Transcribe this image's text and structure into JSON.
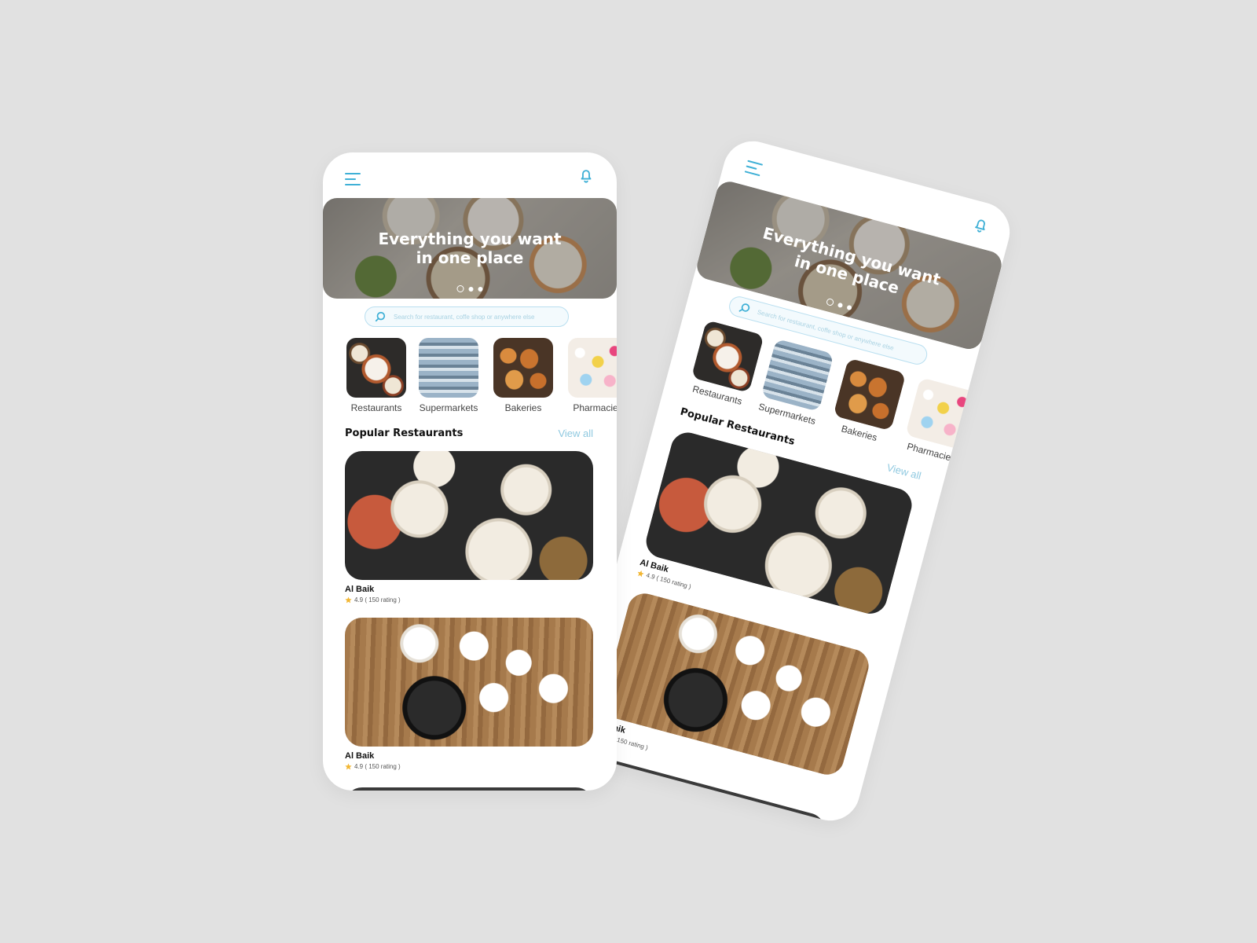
{
  "app": {
    "hero": {
      "title_line1": "Everything you want",
      "title_line2": "in one place",
      "slides": 3,
      "active_slide": 1
    },
    "search": {
      "placeholder": "Search for restaurant, coffe shop or anywhere else"
    },
    "categories": [
      {
        "label": "Restaurants",
        "image": "restaurants-photo"
      },
      {
        "label": "Supermarkets",
        "image": "supermarkets-photo"
      },
      {
        "label": "Bakeries",
        "image": "bakeries-photo"
      },
      {
        "label": "Pharmacies",
        "image": "pharmacies-photo"
      }
    ],
    "popular": {
      "title": "Popular Restaurants",
      "view_all": "View all",
      "items": [
        {
          "name": "Al Baik",
          "rating_text": "4.9 ( 150 rating )",
          "image": "burger-fries-table-photo"
        },
        {
          "name": "Al Baik",
          "rating_text": "4.9 ( 150 rating )",
          "image": "korean-bowls-table-photo"
        }
      ]
    },
    "icons": {
      "menu": "menu-icon",
      "bell": "bell-icon",
      "search": "search-icon",
      "star": "star-icon"
    }
  },
  "colors": {
    "accent": "#3fb0d6",
    "view_all": "#8fc9e0",
    "background": "#e1e1e1",
    "star": "#f2b632"
  }
}
